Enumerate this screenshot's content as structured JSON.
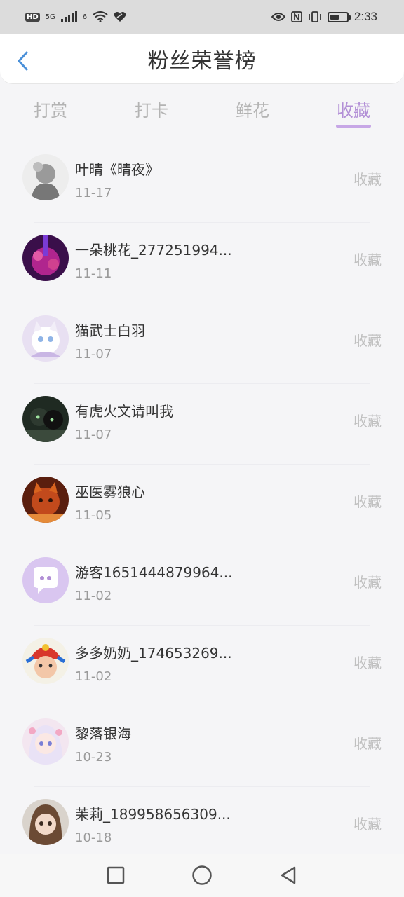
{
  "status_bar": {
    "left_badge": "HD",
    "network": "5G",
    "wifi_tag": "6",
    "time": "2:33"
  },
  "header": {
    "title": "粉丝荣誉榜",
    "back_icon": "chevron-left-icon",
    "accent": "#4a90d9"
  },
  "tabs": [
    {
      "label": "打赏",
      "active": false
    },
    {
      "label": "打卡",
      "active": false
    },
    {
      "label": "鲜花",
      "active": false
    },
    {
      "label": "收藏",
      "active": true
    }
  ],
  "accent_color": "#b28fd6",
  "list": [
    {
      "name": "叶晴《晴夜》",
      "date": "11-17",
      "action": "收藏"
    },
    {
      "name": "一朵桃花_277251994...",
      "date": "11-11",
      "action": "收藏"
    },
    {
      "name": "猫武士白羽",
      "date": "11-07",
      "action": "收藏"
    },
    {
      "name": "有虎火文请叫我",
      "date": "11-07",
      "action": "收藏"
    },
    {
      "name": "巫医雾狼心",
      "date": "11-05",
      "action": "收藏"
    },
    {
      "name": "游客1651444879964...",
      "date": "11-02",
      "action": "收藏"
    },
    {
      "name": "多多奶奶_174653269...",
      "date": "11-02",
      "action": "收藏"
    },
    {
      "name": "黎落银海",
      "date": "10-23",
      "action": "收藏"
    },
    {
      "name": "茉莉_189958656309...",
      "date": "10-18",
      "action": "收藏"
    }
  ],
  "nav": {
    "icons": [
      "square-recents-icon",
      "circle-home-icon",
      "triangle-back-icon"
    ]
  }
}
